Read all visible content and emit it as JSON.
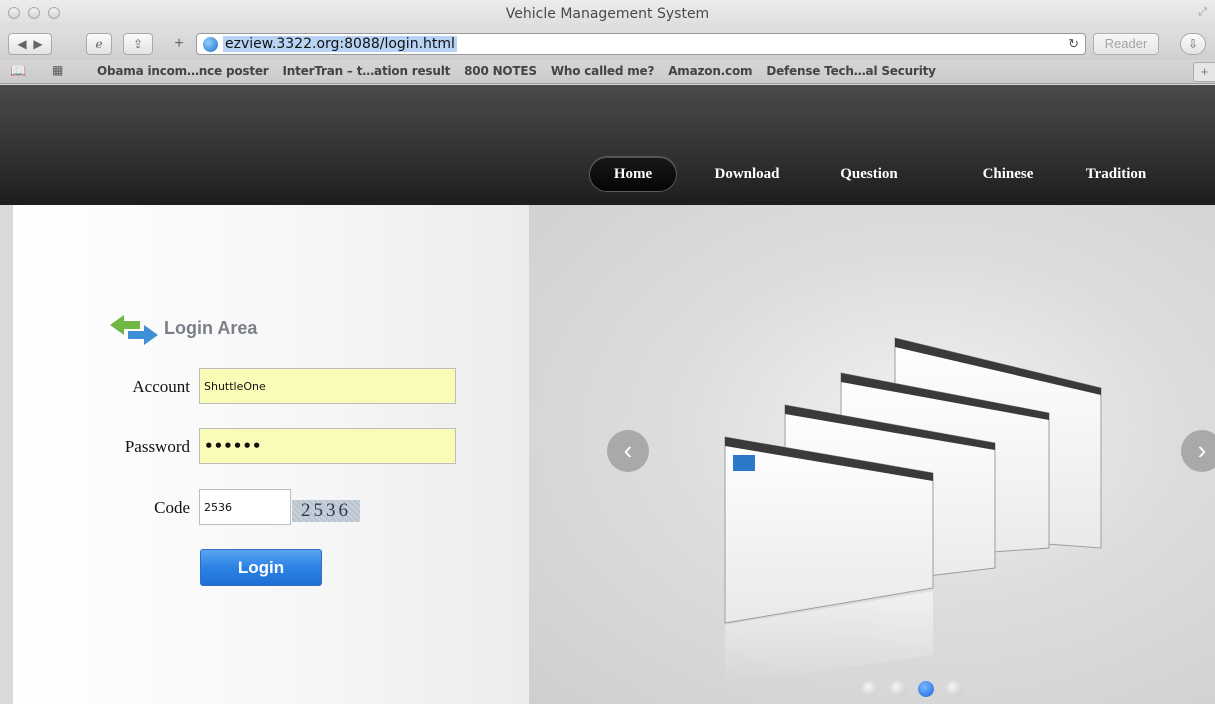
{
  "window": {
    "title": "Vehicle Management System"
  },
  "toolbar": {
    "url": "ezview.3322.org:8088/login.html",
    "reader_label": "Reader"
  },
  "bookmarks": [
    "Obama incom…nce poster",
    "InterTran – t…ation result",
    "800 NOTES",
    "Who called me?",
    "Amazon.com",
    "Defense Tech…al Security"
  ],
  "nav": {
    "home": "Home",
    "download": "Download",
    "question": "Question",
    "chinese": "Chinese",
    "tradition": "Tradition"
  },
  "login": {
    "title": "Login Area",
    "account_label": "Account",
    "account_value": "ShuttleOne",
    "password_label": "Password",
    "password_value": "••••••",
    "code_label": "Code",
    "code_value": "2536",
    "captcha_text": "2536",
    "button_label": "Login"
  },
  "slider": {
    "slide_count": 4,
    "active_index": 2
  },
  "colors": {
    "accent": "#2c82e5",
    "field_bg": "#fbfbb8",
    "header": "#2a2a2a"
  }
}
